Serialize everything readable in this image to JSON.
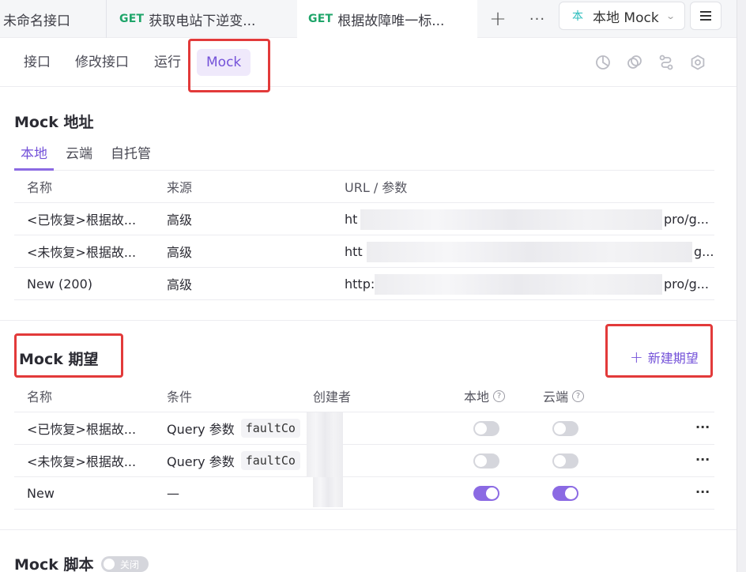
{
  "tabs": [
    {
      "label": "未命名接口"
    },
    {
      "method": "GET",
      "label": "获取电站下逆变..."
    },
    {
      "method": "GET",
      "label": "根据故障唯一标..."
    }
  ],
  "env": {
    "icon": "本",
    "label": "本地 Mock"
  },
  "subnav": [
    "接口",
    "修改接口",
    "运行",
    "Mock"
  ],
  "mock_address": {
    "title": "Mock 地址",
    "tabs": [
      "本地",
      "云端",
      "自托管"
    ],
    "columns": [
      "名称",
      "来源",
      "URL / 参数"
    ],
    "rows": [
      {
        "name": "<已恢复>根据故...",
        "source": "高级",
        "url_start": "ht",
        "url_end": "pro/g..."
      },
      {
        "name": "<未恢复>根据故...",
        "source": "高级",
        "url_start": "htt",
        "url_end": "g..."
      },
      {
        "name": "New (200)",
        "source": "高级",
        "url_start": "http:",
        "url_end": "pro/g..."
      }
    ]
  },
  "mock_expect": {
    "title": "Mock 期望",
    "new_label": "新建期望",
    "columns": [
      "名称",
      "条件",
      "创建者",
      "本地",
      "云端"
    ],
    "rows": [
      {
        "name": "<已恢复>根据故...",
        "cond": "Query 参数",
        "code": "faultCo",
        "local": false,
        "cloud": false
      },
      {
        "name": "<未恢复>根据故...",
        "cond": "Query 参数",
        "code": "faultCo",
        "local": false,
        "cloud": false
      },
      {
        "name": "New",
        "cond": "—",
        "code": "",
        "local": true,
        "cloud": true
      }
    ],
    "help_icon": "?",
    "more_icon": "···"
  },
  "mock_script": {
    "title": "Mock 脚本",
    "switch_label": "关闭"
  },
  "colors": {
    "accent": "#7452d9",
    "highlight_box": "#e23a3a",
    "get_method": "#1fa56a"
  }
}
